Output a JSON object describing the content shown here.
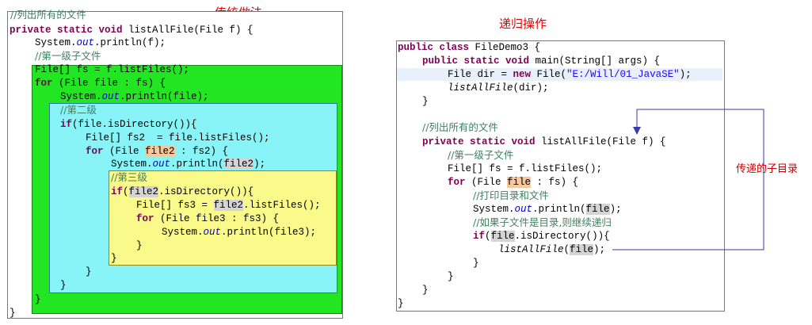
{
  "titles": {
    "traditional": "传统做法",
    "recursive": "递归操作"
  },
  "annotation": {
    "side_label": "传递的子目录"
  },
  "colors": {
    "level1_bg": "#22e622",
    "level2_bg": "#88f4f8",
    "level3_bg": "#fafa8a",
    "title_red": "#e60000",
    "arrow_blue": "#3a3aa8"
  },
  "left_code": {
    "l0": "//列出所有的文件",
    "l1_kw": "private static void",
    "l1_rest": " listAllFile(File f) {",
    "l2_a": "System.",
    "l2_out": "out",
    "l2_b": ".println(f);",
    "l3": "//第一级子文件",
    "l4": "File[] fs = f.listFiles();",
    "l5_kw": "for",
    "l5_rest": " (File file : fs) {",
    "l6_a": "System.",
    "l6_out": "out",
    "l6_b": ".println(file);",
    "l7": "//第二级",
    "l8_kw": "if",
    "l8_rest": "(file.isDirectory()){",
    "l9": "File[] fs2  = file.listFiles();",
    "l10_kw": "for",
    "l10_a": " (File ",
    "l10_hl": "file2",
    "l10_b": " : fs2) {",
    "l11_a": "System.",
    "l11_out": "out",
    "l11_b": ".println(",
    "l11_hl": "file2",
    "l11_c": ");",
    "l12": "//第三级",
    "l13_kw": "if",
    "l13_a": "(",
    "l13_hl": "file2",
    "l13_b": ".isDirectory()){",
    "l14_a": "File[] fs3 = ",
    "l14_hl": "file2",
    "l14_b": ".listFiles();",
    "l15_kw": "for",
    "l15_rest": " (File file3 : fs3) {",
    "l16_a": "System.",
    "l16_out": "out",
    "l16_b": ".println(file3);",
    "close": "}"
  },
  "right_code": {
    "r0_kw": "public class",
    "r0_rest": " FileDemo3 {",
    "r1_kw": "public static void",
    "r1_rest": " main(String[] args) {",
    "r2_a": "File dir = ",
    "r2_kw": "new",
    "r2_b": " File(",
    "r2_str": "\"E:/Will/01_JavaSE\"",
    "r2_c": ");",
    "r3_method": "listAllFile",
    "r3_rest": "(dir);",
    "r5": "//列出所有的文件",
    "r6_kw": "private static void",
    "r6_rest": " listAllFile(File f) {",
    "r7": "//第一级子文件",
    "r8": "File[] fs = f.listFiles();",
    "r9_kw": "for",
    "r9_a": " (File ",
    "r9_hl": "file",
    "r9_b": " : fs) {",
    "r10": "//打印目录和文件",
    "r11_a": "System.",
    "r11_out": "out",
    "r11_b": ".println(",
    "r11_hl": "file",
    "r11_c": ");",
    "r12": "//如果子文件是目录,则继续递归",
    "r13_kw": "if",
    "r13_a": "(",
    "r13_hl": "file",
    "r13_b": ".isDirectory()){",
    "r14_method": "listAllFile",
    "r14_a": "(",
    "r14_hl": "file",
    "r14_b": ");",
    "close": "}"
  }
}
